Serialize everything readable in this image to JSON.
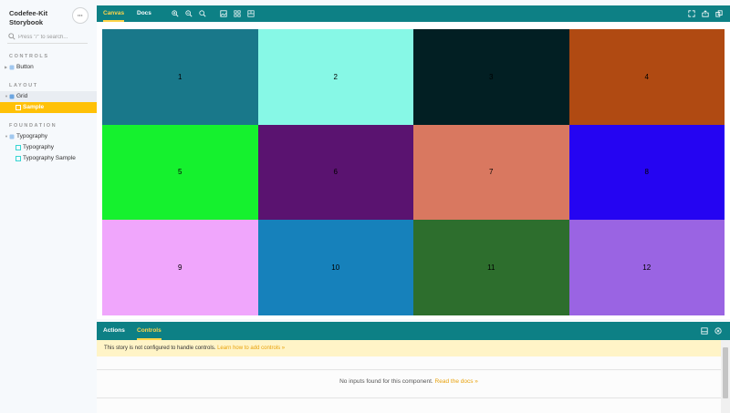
{
  "sidebar": {
    "brand_line1": "Codefee-Kit",
    "brand_line2": "Storybook",
    "menu_glyph": "•••",
    "search_placeholder": "Press \"/\" to search...",
    "sections": {
      "controls": "CONTROLS",
      "layout": "LAYOUT",
      "foundation": "FOUNDATION"
    },
    "items": {
      "button": "Button",
      "grid": "Grid",
      "sample": "Sample",
      "typography": "Typography",
      "typography_story": "Typography",
      "typography_sample": "Typography Sample"
    }
  },
  "toolbar": {
    "canvas_tab": "Canvas",
    "docs_tab": "Docs",
    "icons": [
      "zoom-in-icon",
      "zoom-out-icon",
      "zoom-reset-icon",
      "background-icon",
      "grid-icon",
      "measure-icon",
      "fullscreen-icon",
      "share-icon",
      "copy-link-icon"
    ]
  },
  "grid_cells": [
    {
      "label": "1",
      "color": "#19788a"
    },
    {
      "label": "2",
      "color": "#87f8e6"
    },
    {
      "label": "3",
      "color": "#021f23"
    },
    {
      "label": "4",
      "color": "#b04a12"
    },
    {
      "label": "5",
      "color": "#15f12e"
    },
    {
      "label": "6",
      "color": "#5a1370"
    },
    {
      "label": "7",
      "color": "#d97860"
    },
    {
      "label": "8",
      "color": "#2504f2"
    },
    {
      "label": "9",
      "color": "#f0a6fc"
    },
    {
      "label": "10",
      "color": "#1681bb"
    },
    {
      "label": "11",
      "color": "#2d6e2d"
    },
    {
      "label": "12",
      "color": "#9a64e3"
    }
  ],
  "addons": {
    "actions_tab": "Actions",
    "controls_tab": "Controls",
    "notice_text": "This story is not configured to handle controls.",
    "notice_link": "Learn how to add controls »",
    "empty_text": "No inputs found for this component.",
    "empty_link": "Read the docs »"
  },
  "colors": {
    "toolbar_bg": "#0d8085",
    "accent": "#ffd54a",
    "selected_story": "#ffc107"
  }
}
